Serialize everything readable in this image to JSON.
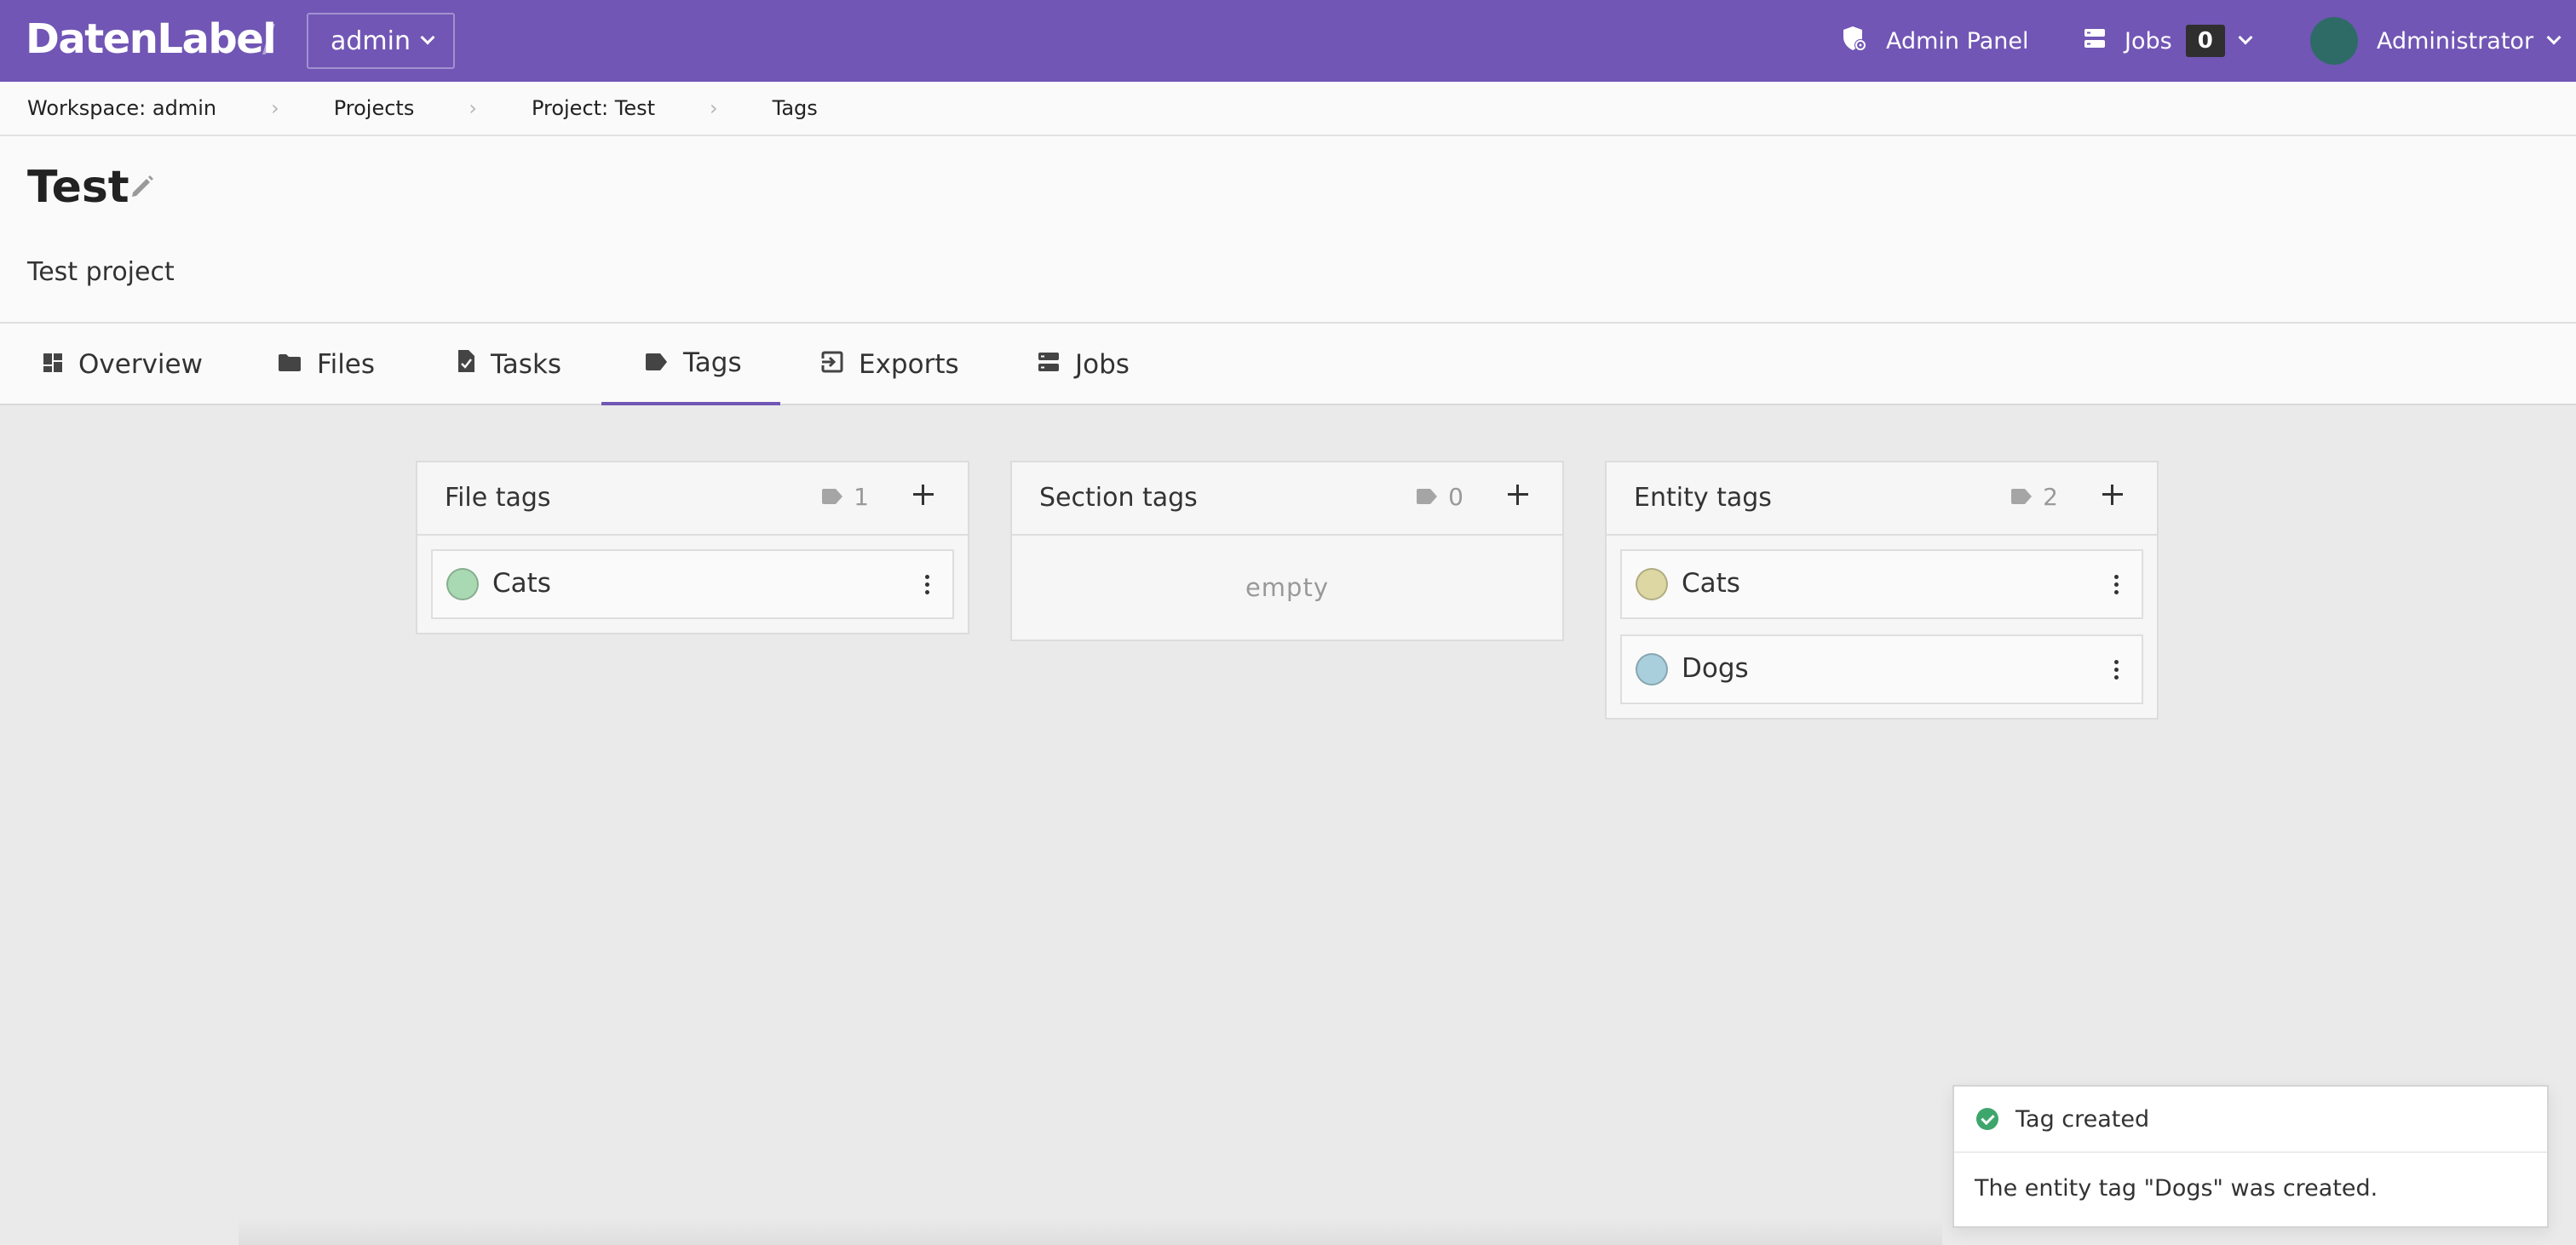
{
  "navbar": {
    "brand": "DatenLabel",
    "workspace": "admin",
    "admin_panel": "Admin Panel",
    "jobs_label": "Jobs",
    "jobs_count": "0",
    "user_name": "Administrator",
    "colors": {
      "bar": "#7156b5",
      "avatar": "#2e6b67"
    }
  },
  "breadcrumb": {
    "items": [
      "Workspace: admin",
      "Projects",
      "Project: Test",
      "Tags"
    ]
  },
  "project": {
    "title": "Test",
    "description": "Test project"
  },
  "tabs": [
    {
      "label": "Overview",
      "icon": "dashboard-icon"
    },
    {
      "label": "Files",
      "icon": "folder-icon"
    },
    {
      "label": "Tasks",
      "icon": "task-file-icon"
    },
    {
      "label": "Tags",
      "icon": "tag-icon",
      "active": true
    },
    {
      "label": "Exports",
      "icon": "export-icon"
    },
    {
      "label": "Jobs",
      "icon": "server-icon"
    }
  ],
  "cards": [
    {
      "title": "File tags",
      "count": "1",
      "tags": [
        {
          "name": "Cats",
          "color": "#a9d9b2"
        }
      ]
    },
    {
      "title": "Section tags",
      "count": "0",
      "empty_text": "empty",
      "tags": []
    },
    {
      "title": "Entity tags",
      "count": "2",
      "tags": [
        {
          "name": "Cats",
          "color": "#dcd7a3"
        },
        {
          "name": "Dogs",
          "color": "#a9cfdc"
        }
      ]
    }
  ],
  "toast": {
    "title": "Tag created",
    "message": "The entity tag \"Dogs\" was created."
  }
}
